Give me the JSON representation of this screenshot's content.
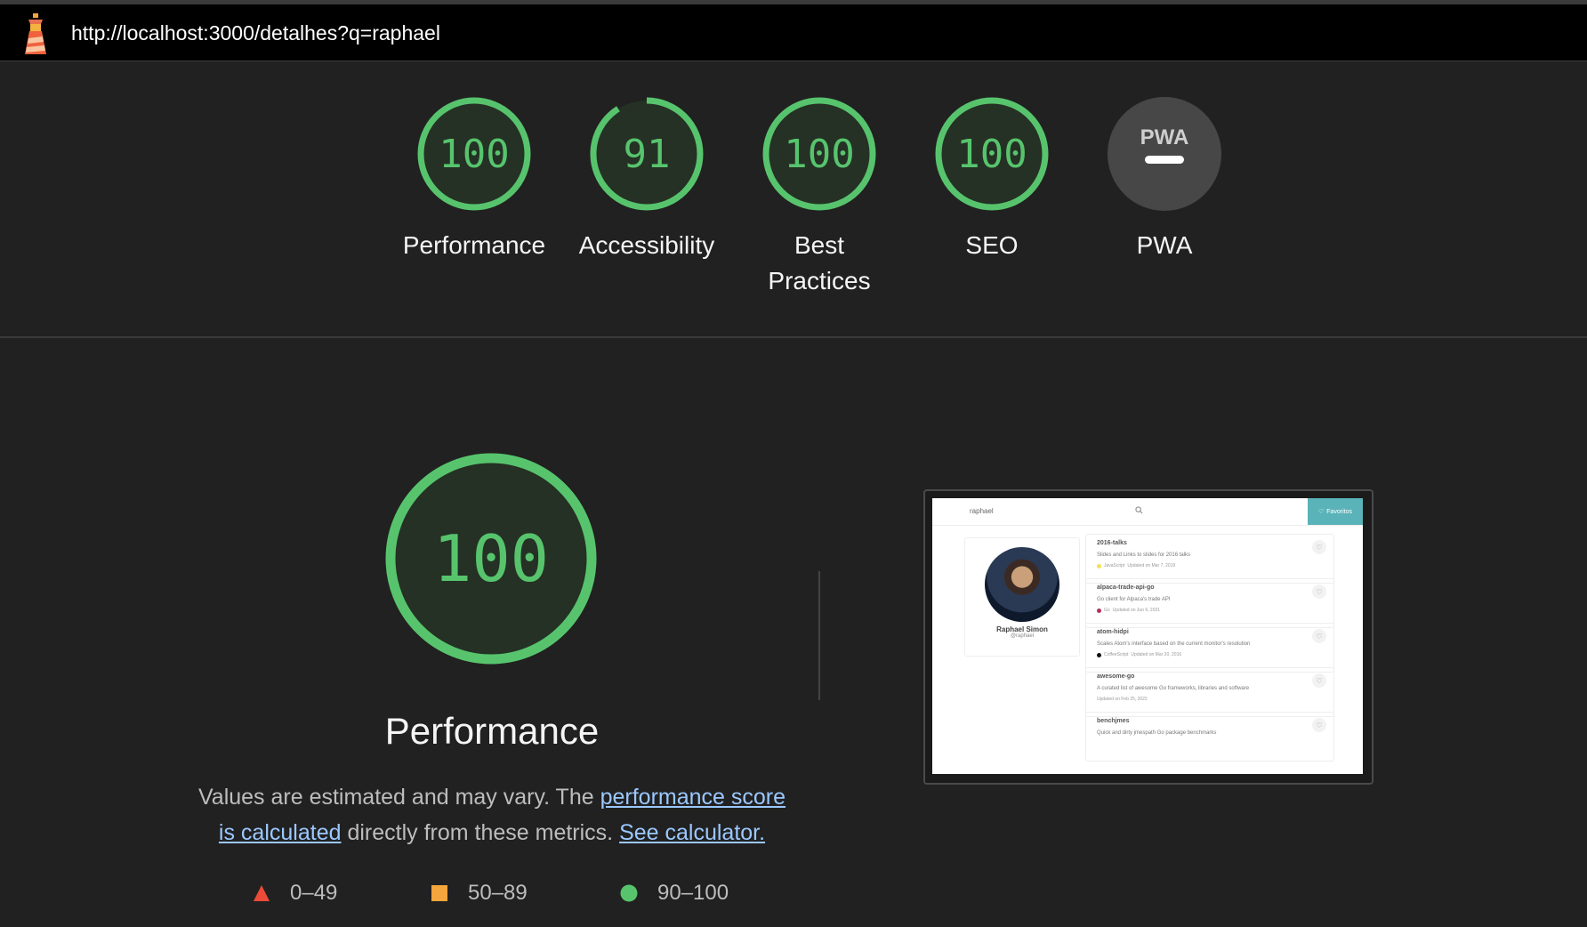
{
  "url": "http://localhost:3000/detalhes?q=raphael",
  "colors": {
    "pass": "#57c46d",
    "average": "#f4a53d",
    "fail": "#eb4b38",
    "link": "#9bc8ff",
    "pwa_bg": "#474747"
  },
  "gauges": [
    {
      "score": "100",
      "value": 1.0,
      "label": "Performance"
    },
    {
      "score": "91",
      "value": 0.91,
      "label": "Accessibility"
    },
    {
      "score": "100",
      "value": 1.0,
      "label": "Best Practices"
    },
    {
      "score": "100",
      "value": 1.0,
      "label": "SEO"
    },
    {
      "badge": "PWA",
      "label": "PWA"
    }
  ],
  "main": {
    "score": "100",
    "value": 1.0,
    "title": "Performance",
    "desc_prefix": "Values are estimated and may vary. The ",
    "desc_link1": "performance score is calculated",
    "desc_middle": " directly from these metrics. ",
    "desc_link2": "See calculator."
  },
  "legend": [
    {
      "shape": "triangle",
      "range": "0–49"
    },
    {
      "shape": "square",
      "range": "50–89"
    },
    {
      "shape": "circle",
      "range": "90–100"
    }
  ],
  "screenshot": {
    "search_value": "raphael",
    "favorites_label": "Favoritos",
    "profile_name": "Raphael Simon",
    "profile_handle": "@raphael",
    "repos": [
      {
        "name": "2016-talks",
        "desc": "Slides and Links to slides for 2016 talks",
        "lang": "JavaScript",
        "lang_color": "#f1e05a",
        "updated": "Updated on Mar 7, 2019"
      },
      {
        "name": "alpaca-trade-api-go",
        "desc": "Go client for Alpaca's trade API",
        "lang": "Go",
        "lang_color": "#b3305a",
        "updated": "Updated on Jun 6, 2021"
      },
      {
        "name": "atom-hidpi",
        "desc": "Scales Atom's interface based on the current monitor's resolution",
        "lang": "CoffeeScript",
        "lang_color": "#111111",
        "updated": "Updated on Mar 20, 2016"
      },
      {
        "name": "awesome-go",
        "desc": "A curated list of awesome Go frameworks, libraries and software",
        "lang": "",
        "lang_color": "",
        "updated": "Updated on Feb 25, 2022"
      },
      {
        "name": "benchjmes",
        "desc": "Quick and dirty jmespath Go package benchmarks",
        "lang": "",
        "lang_color": "",
        "updated": ""
      }
    ]
  }
}
